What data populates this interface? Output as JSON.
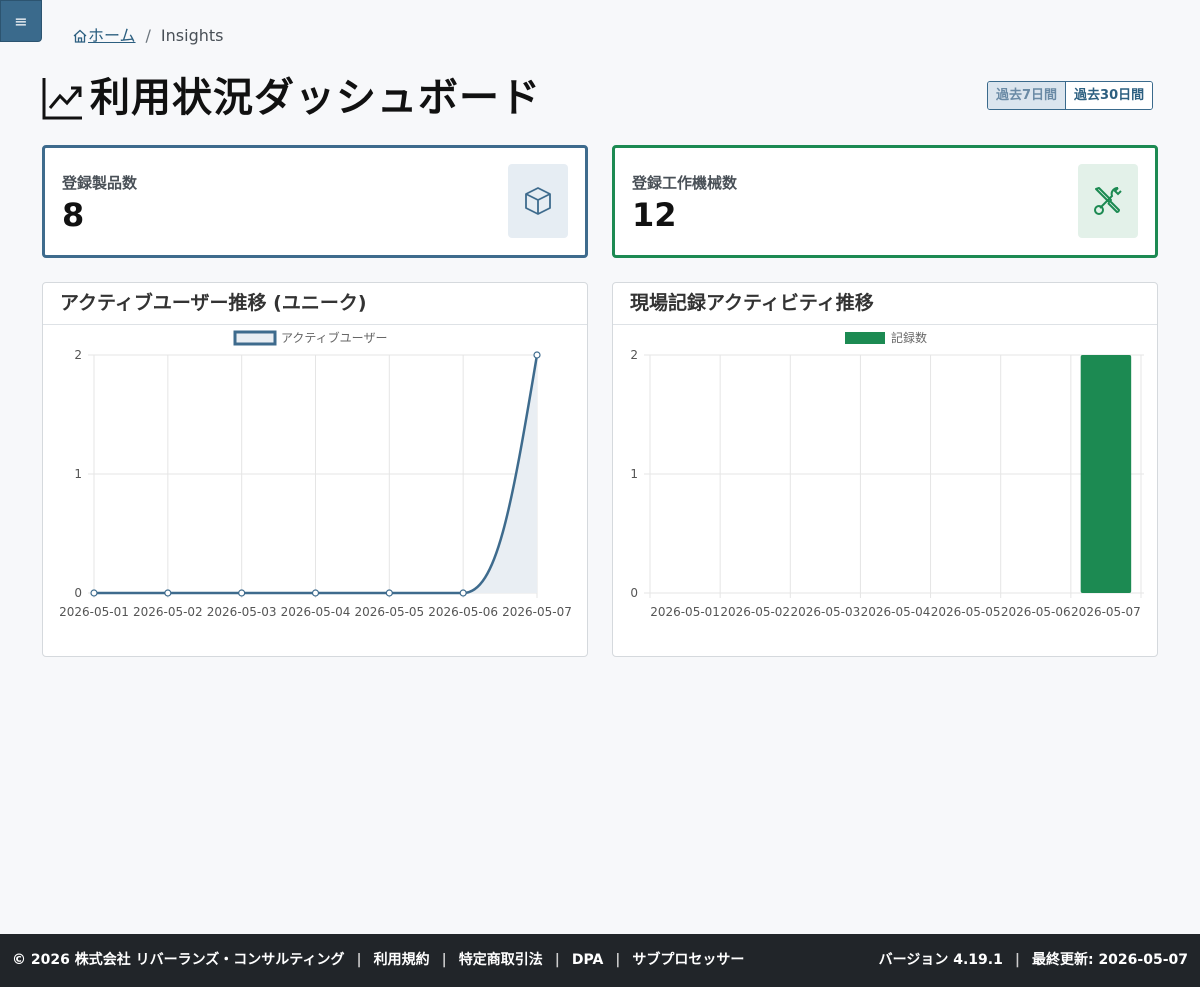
{
  "menu": {
    "label": "≡"
  },
  "breadcrumb": {
    "home": "ホーム",
    "separator": "/",
    "current": "Insights"
  },
  "page": {
    "title": "利用状況ダッシュボード"
  },
  "range": {
    "options": [
      "過去7日間",
      "過去30日間"
    ],
    "selected": "過去7日間"
  },
  "stats": [
    {
      "label": "登録製品数",
      "value": "8",
      "icon": "box-icon",
      "color": "#3e6b8d"
    },
    {
      "label": "登録工作機械数",
      "value": "12",
      "icon": "tools-icon",
      "color": "#1c8a52"
    }
  ],
  "charts": {
    "users": {
      "title": "アクティブユーザー推移 (ユニーク)"
    },
    "activity": {
      "title": "現場記録アクティビティ推移"
    }
  },
  "chart_data": [
    {
      "type": "area",
      "title": "アクティブユーザー推移 (ユニーク)",
      "categories": [
        "2026-05-01",
        "2026-05-02",
        "2026-05-03",
        "2026-05-04",
        "2026-05-05",
        "2026-05-06",
        "2026-05-07"
      ],
      "series": [
        {
          "name": "アクティブユーザー",
          "values": [
            0,
            0,
            0,
            0,
            0,
            0,
            2
          ],
          "color": "#3e6b8d"
        }
      ],
      "yticks": [
        "0",
        "1",
        "2"
      ],
      "ylim": [
        0,
        2
      ],
      "legend": "top",
      "grid": true
    },
    {
      "type": "bar",
      "title": "現場記録アクティビティ推移",
      "categories": [
        "2026-05-01",
        "2026-05-02",
        "2026-05-03",
        "2026-05-04",
        "2026-05-05",
        "2026-05-06",
        "2026-05-07"
      ],
      "series": [
        {
          "name": "記録数",
          "values": [
            0,
            0,
            0,
            0,
            0,
            0,
            2
          ],
          "color": "#1c8a52"
        }
      ],
      "yticks": [
        "0",
        "1",
        "2"
      ],
      "ylim": [
        0,
        2
      ],
      "legend": "top",
      "grid": true
    }
  ],
  "footer": {
    "links": [
      "© 2026 株式会社 リバーランズ・コンサルティング",
      "利用規約",
      "特定商取引法",
      "DPA",
      "サブプロセッサー"
    ],
    "separator": "|",
    "version": "バージョン 4.19.1",
    "updated": "最終更新: 2026-05-07"
  }
}
